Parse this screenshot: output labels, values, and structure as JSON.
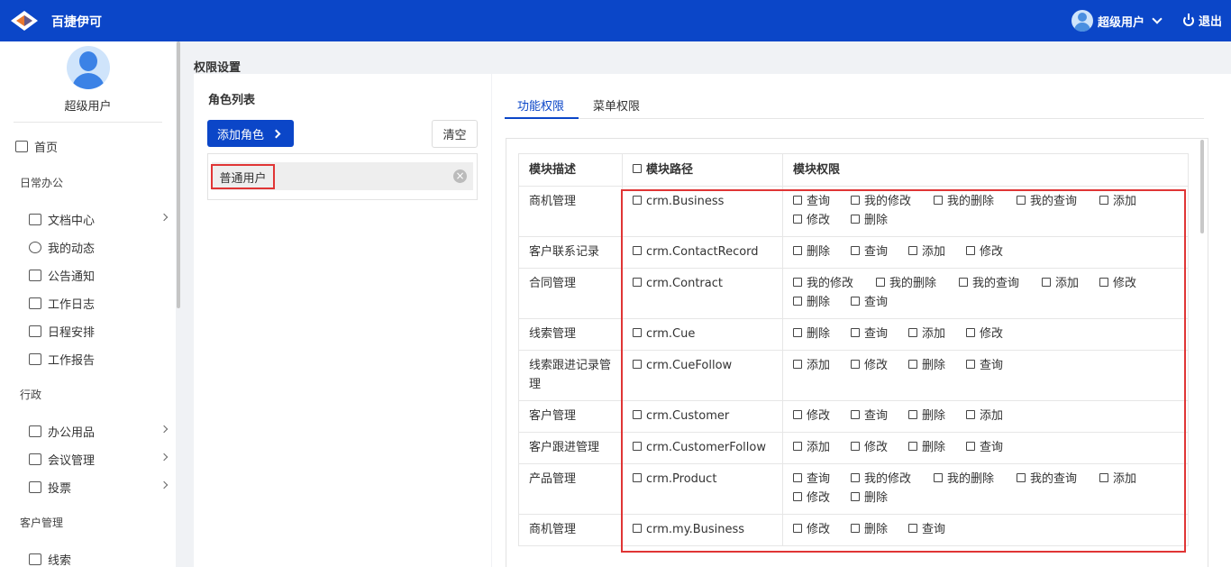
{
  "app": {
    "brand": "百捷伊可",
    "user_name": "超级用户",
    "logout": "退出"
  },
  "sidebar": {
    "user": "超级用户",
    "home": "首页",
    "sections": [
      {
        "title": "日常办公",
        "items": [
          "文档中心",
          "我的动态",
          "公告通知",
          "工作日志",
          "日程安排",
          "工作报告"
        ]
      },
      {
        "title": "行政",
        "items": [
          "办公用品",
          "会议管理",
          "投票"
        ]
      },
      {
        "title": "客户管理",
        "items": [
          "线索"
        ]
      }
    ]
  },
  "page": {
    "title": "权限设置"
  },
  "roles": {
    "title": "角色列表",
    "add_button": "添加角色",
    "clear_button": "清空",
    "items": [
      "普通用户"
    ]
  },
  "tabs": [
    "功能权限",
    "菜单权限"
  ],
  "table": {
    "headers": [
      "模块描述",
      "模块路径",
      "模块权限"
    ],
    "rows": [
      {
        "desc": "商机管理",
        "path": "crm.Business",
        "perms": [
          "查询",
          "我的修改",
          "我的删除",
          "我的查询",
          "添加",
          "修改",
          "删除"
        ]
      },
      {
        "desc": "客户联系记录",
        "path": "crm.ContactRecord",
        "perms": [
          "删除",
          "查询",
          "添加",
          "修改"
        ]
      },
      {
        "desc": "合同管理",
        "path": "crm.Contract",
        "perms": [
          "我的修改",
          "我的删除",
          "我的查询",
          "添加",
          "修改",
          "删除",
          "查询"
        ]
      },
      {
        "desc": "线索管理",
        "path": "crm.Cue",
        "perms": [
          "删除",
          "查询",
          "添加",
          "修改"
        ]
      },
      {
        "desc": "线索跟进记录管理",
        "path": "crm.CueFollow",
        "perms": [
          "添加",
          "修改",
          "删除",
          "查询"
        ]
      },
      {
        "desc": "客户管理",
        "path": "crm.Customer",
        "perms": [
          "修改",
          "查询",
          "删除",
          "添加"
        ]
      },
      {
        "desc": "客户跟进管理",
        "path": "crm.CustomerFollow",
        "perms": [
          "添加",
          "修改",
          "删除",
          "查询"
        ]
      },
      {
        "desc": "产品管理",
        "path": "crm.Product",
        "perms": [
          "查询",
          "我的修改",
          "我的删除",
          "我的查询",
          "添加",
          "修改",
          "删除"
        ]
      },
      {
        "desc": "商机管理",
        "path": "crm.my.Business",
        "perms": [
          "修改",
          "删除",
          "查询"
        ]
      }
    ]
  },
  "colors": {
    "primary": "#0b46c8",
    "highlight": "#e03535"
  }
}
